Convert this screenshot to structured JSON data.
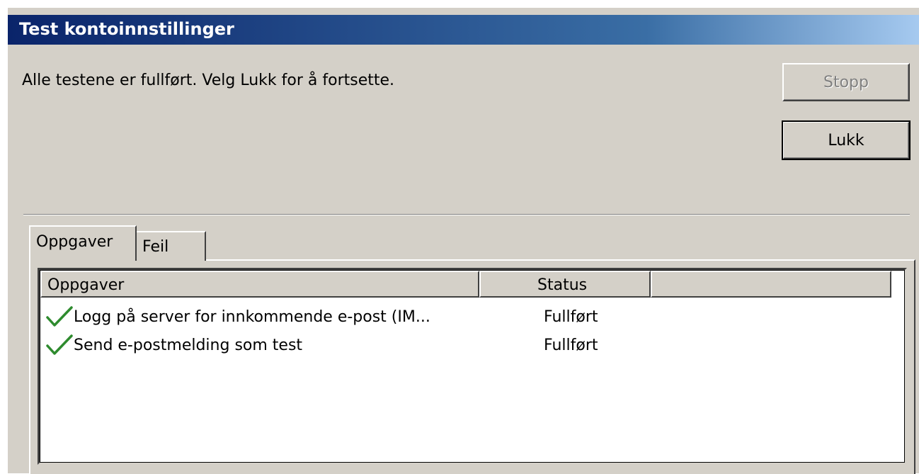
{
  "window": {
    "title": "Test kontoinnstillinger"
  },
  "message": "Alle testene er fullført. Velg Lukk for å fortsette.",
  "buttons": {
    "stop_label": "Stopp",
    "close_label": "Lukk"
  },
  "tabs": [
    {
      "label": "Oppgaver",
      "active": true
    },
    {
      "label": "Feil",
      "active": false
    }
  ],
  "table": {
    "columns": [
      "Oppgaver",
      "Status",
      ""
    ],
    "rows": [
      {
        "icon": "checkmark-icon",
        "task": "Logg på server for innkommende e-post (IM...",
        "status": "Fullført"
      },
      {
        "icon": "checkmark-icon",
        "task": "Send e-postmelding som test",
        "status": "Fullført"
      }
    ]
  },
  "colors": {
    "title_start": "#0a246a",
    "title_end": "#a6caf0",
    "face": "#d4d0c8",
    "check_green": "#2e8b2e"
  }
}
